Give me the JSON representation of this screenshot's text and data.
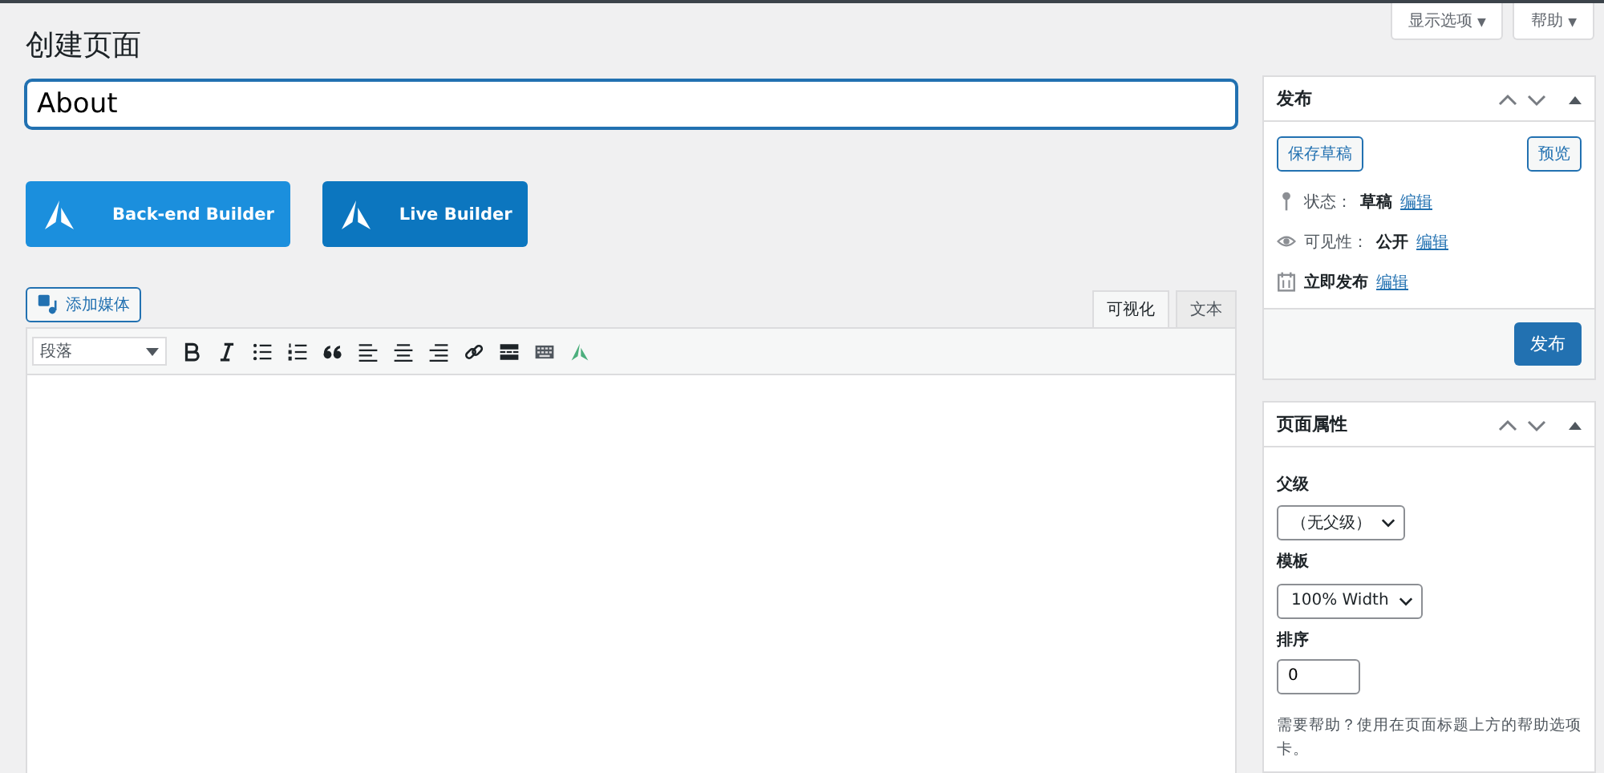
{
  "screen_options": [
    {
      "label": "显示选项",
      "caret": "▼"
    },
    {
      "label": "帮助",
      "caret": "▼"
    }
  ],
  "page_title": "创建页面",
  "title_field": {
    "value": "About"
  },
  "builder_buttons": [
    {
      "label": "Back-end Builder",
      "kind": "backend"
    },
    {
      "label": "Live Builder",
      "kind": "live"
    }
  ],
  "add_media": {
    "label": "添加媒体"
  },
  "editor_tabs": [
    {
      "label": "可视化",
      "selected": true
    },
    {
      "label": "文本",
      "selected": false
    }
  ],
  "toolbar": {
    "format": "段落"
  },
  "publish_box": {
    "title": "发布",
    "save_draft": "保存草稿",
    "preview": "预览",
    "rows": [
      {
        "label": "状态：",
        "value": "草稿",
        "link": "编辑"
      },
      {
        "label": "可见性：",
        "value": "公开",
        "link": "编辑"
      },
      {
        "value": "立即发布",
        "link": "编辑"
      }
    ],
    "publish": "发布"
  },
  "attributes_box": {
    "title": "页面属性",
    "parent_label": "父级",
    "parent_value": "（无父级）",
    "template_label": "模板",
    "template_value": "100% Width",
    "order_label": "排序",
    "order_value": "0",
    "help": "需要帮助？使用在页面标题上方的帮助选项卡。"
  }
}
